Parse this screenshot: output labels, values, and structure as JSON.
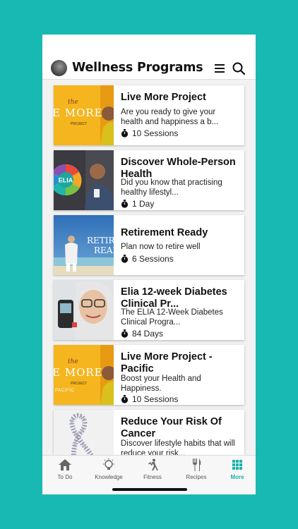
{
  "header": {
    "title": "Wellness Programs",
    "avatar_icon": "user-avatar",
    "menu_icon": "hamburger-menu-icon",
    "search_icon": "search-icon"
  },
  "colors": {
    "accent": "#19b3ac",
    "background": "#18b9b2",
    "card": "#ffffff",
    "yellow_thumb": "#f5b51e"
  },
  "programs": [
    {
      "title": "Live More Project",
      "description": "Are you ready to give your health and happiness a b...",
      "meta": "10 Sessions",
      "thumb_text": {
        "script": "the",
        "main": "E MORE",
        "sub": "PROJECT"
      }
    },
    {
      "title": "Discover Whole-Person Health",
      "description": "Did you know that practising healthy lifestyl...",
      "meta": "1 Day",
      "thumb_text": {
        "main": "ELIA"
      }
    },
    {
      "title": "Retirement Ready",
      "description": "Plan now to retire well",
      "meta": "6 Sessions",
      "thumb_text": {
        "line1": "RETIR",
        "line2": "READ"
      }
    },
    {
      "title": "Elia 12-week Diabetes Clinical Pr...",
      "description": "The ELIA 12-Week Diabetes Clinical Progra...",
      "meta": "84 Days"
    },
    {
      "title": "Live More Project - Pacific",
      "description": "Boost your Health and Happiness.",
      "meta": "10 Sessions",
      "thumb_text": {
        "script": "the",
        "main": "E MORE",
        "sub": "PROJECT",
        "sub2": "PACIFIC"
      }
    },
    {
      "title": "Reduce Your Risk Of Cancer",
      "description": "Discover lifestyle habits that will reduce your risk...",
      "meta": ""
    }
  ],
  "tabs": [
    {
      "label": "To Do",
      "icon": "home-icon",
      "active": false
    },
    {
      "label": "Knowledge",
      "icon": "lightbulb-icon",
      "active": false
    },
    {
      "label": "Fitness",
      "icon": "running-person-icon",
      "active": false
    },
    {
      "label": "Recipes",
      "icon": "fork-knife-icon",
      "active": false
    },
    {
      "label": "More",
      "icon": "grid-icon",
      "active": true
    }
  ]
}
